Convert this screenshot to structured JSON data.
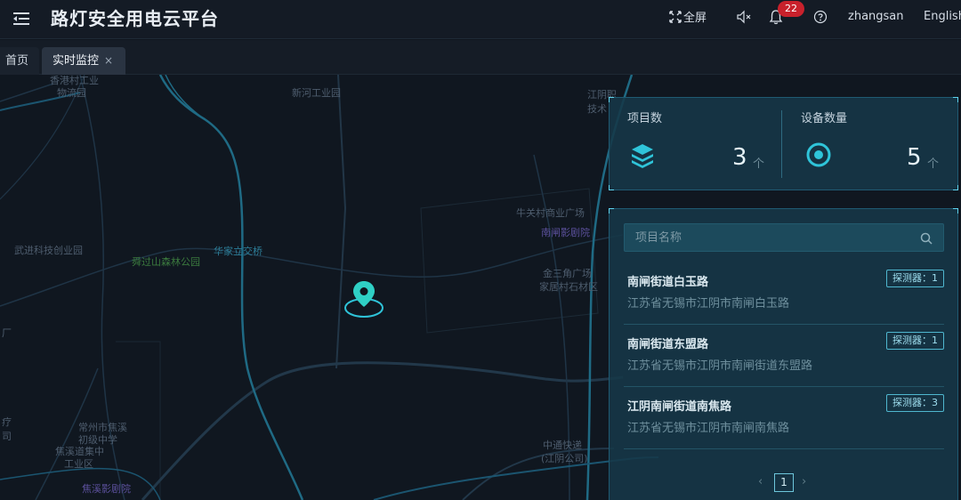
{
  "header": {
    "title": "路灯安全用电云平台",
    "fullscreen_label": "全屏",
    "notification_count": "22",
    "username": "zhangsan",
    "language": "English"
  },
  "tabs": [
    {
      "label": "首页"
    },
    {
      "label": "实时监控",
      "close": "×"
    }
  ],
  "map_labels": [
    "新河工业园",
    "江阴职",
    "技术",
    "牛关村商业广场",
    "南闸影剧院",
    "金三角广场",
    "家居村石材区",
    "武进科技创业园",
    "舜过山森林公园",
    "华家立交桥",
    "中通快递",
    "(江阴公司)",
    "常州市焦溪",
    "初级中学",
    "焦溪道集中",
    "工业区",
    "焦溪影剧院",
    "香港村工业",
    "物流园",
    "厂",
    "疗",
    "司"
  ],
  "stats": {
    "projects": {
      "label": "项目数",
      "value": "3",
      "unit": "个"
    },
    "devices": {
      "label": "设备数量",
      "value": "5",
      "unit": "个"
    }
  },
  "search": {
    "placeholder": "项目名称"
  },
  "projects": [
    {
      "name": "南闸街道白玉路",
      "address": "江苏省无锡市江阴市南闸白玉路",
      "tag": "探测器：1"
    },
    {
      "name": "南闸街道东盟路",
      "address": "江苏省无锡市江阴市南闸街道东盟路",
      "tag": "探测器：1"
    },
    {
      "name": "江阴南闸街道南焦路",
      "address": "江苏省无锡市江阴市南闸南焦路",
      "tag": "探测器：3"
    }
  ],
  "pager": {
    "prev": "‹",
    "current": "1",
    "next": "›"
  },
  "colors": {
    "accent": "#2fc4d9",
    "panel": "#163848",
    "badge": "#c8212c"
  }
}
